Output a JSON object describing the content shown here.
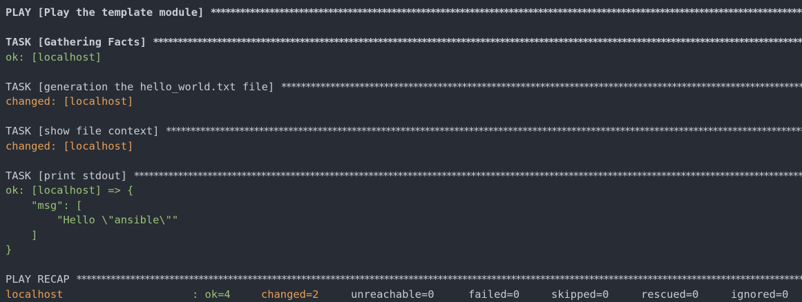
{
  "colors": {
    "background": "#282c34",
    "default_text": "#c8cdd6",
    "ok": "#98c379",
    "changed": "#e5a05a"
  },
  "play_header": "PLAY [Play the template module]",
  "tasks": [
    {
      "header": "TASK [Gathering Facts]",
      "status": "ok: [localhost]"
    },
    {
      "header": "TASK [generation the hello_world.txt file]",
      "status": "changed: [localhost]"
    },
    {
      "header": "TASK [show file context]",
      "status": "changed: [localhost]"
    },
    {
      "header": "TASK [print stdout]",
      "status": "ok: [localhost] => {"
    }
  ],
  "debug_output": {
    "line1": "    \"msg\": [",
    "line2": "        \"Hello \\\"ansible\\\"\"",
    "line3": "    ]",
    "line4": "}"
  },
  "recap": {
    "header": "PLAY RECAP",
    "host": "localhost",
    "ok": ": ok=4",
    "changed": "changed=2",
    "unreachable": "unreachable=0",
    "failed": "failed=0",
    "skipped": "skipped=0",
    "rescued": "rescued=0",
    "ignored": "ignored=0"
  },
  "stars": "****************************************************************************************************************************************************************************************************************"
}
